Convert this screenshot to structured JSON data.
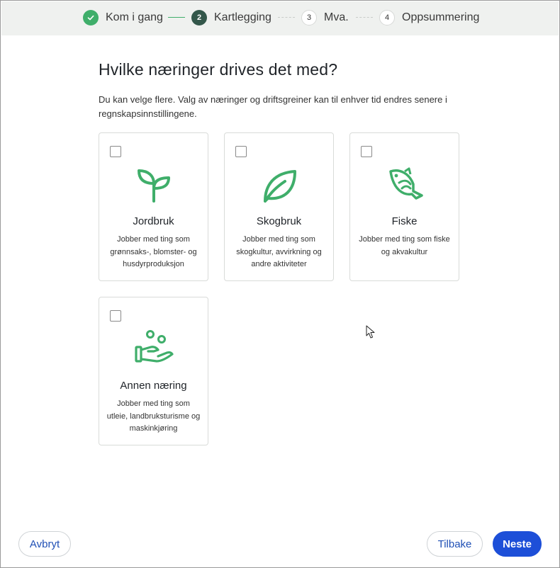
{
  "stepper": {
    "steps": [
      {
        "number": "1",
        "label": "Kom i gang",
        "state": "done"
      },
      {
        "number": "2",
        "label": "Kartlegging",
        "state": "active"
      },
      {
        "number": "3",
        "label": "Mva.",
        "state": "todo"
      },
      {
        "number": "4",
        "label": "Oppsummering",
        "state": "todo"
      }
    ]
  },
  "page": {
    "title": "Hvilke næringer drives det med?",
    "lead": "Du kan velge flere. Valg av næringer og driftsgreiner kan til enhver tid endres senere i regnskapsinnstillingene."
  },
  "cards": [
    {
      "title": "Jordbruk",
      "desc": "Jobber med ting som grønnsaks-, blomster- og husdyrproduksjon",
      "icon": "sprout-icon",
      "checked": false
    },
    {
      "title": "Skogbruk",
      "desc": "Jobber med ting som skogkultur, avvirkning og andre aktiviteter",
      "icon": "leaf-icon",
      "checked": false
    },
    {
      "title": "Fiske",
      "desc": "Jobber med ting som fiske og akvakultur",
      "icon": "fish-icon",
      "checked": false
    },
    {
      "title": "Annen næring",
      "desc": "Jobber med ting som utleie, landbruksturisme og maskinkjøring",
      "icon": "hand-coins-icon",
      "checked": false
    }
  ],
  "footer": {
    "cancel_label": "Avbryt",
    "back_label": "Tilbake",
    "next_label": "Neste"
  },
  "colors": {
    "accent_green": "#3fae6a",
    "active_step": "#33574a",
    "primary_blue": "#1d4fd8"
  }
}
